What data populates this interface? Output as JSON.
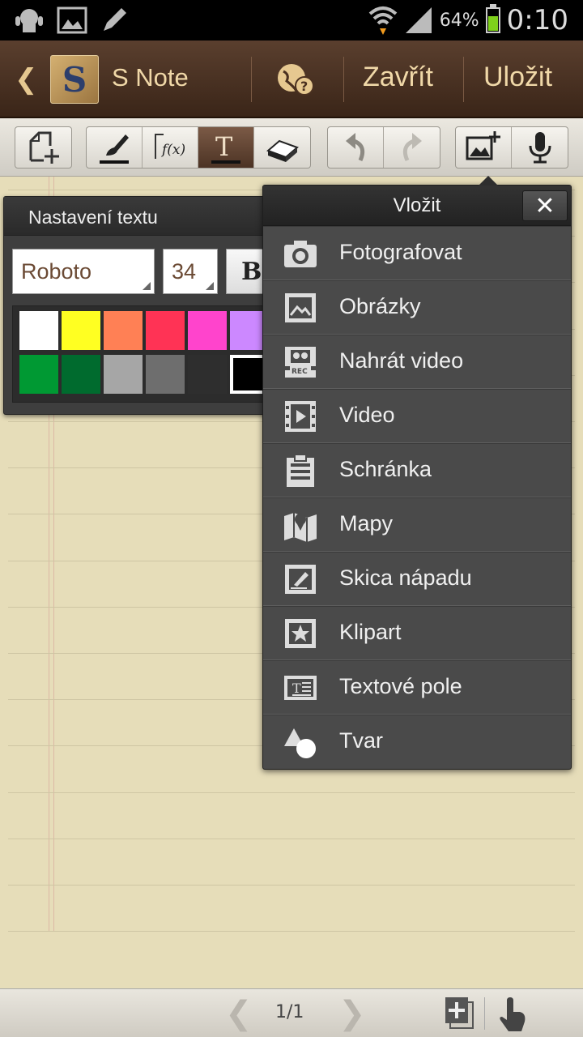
{
  "status_bar": {
    "battery_percent": "64%",
    "time": "0:10",
    "battery_level": 0.64
  },
  "title_bar": {
    "app_name": "S Note",
    "close_label": "Zavřít",
    "save_label": "Uložit"
  },
  "bottom_bar": {
    "page_indicator": "1/1"
  },
  "text_settings": {
    "title": "Nastavení textu",
    "font": "Roboto",
    "size": "34",
    "bold_label": "B",
    "colors_row1": [
      "#ffffff",
      "#ffff22",
      "#ff8055",
      "#ff3355",
      "#ff44cc",
      "#cc88ff"
    ],
    "colors_row2": [
      "#009933",
      "#006b2e",
      "#a6a6a6",
      "#6e6e6e",
      "#2e2e2e",
      "#000000"
    ],
    "selected_color": "#000000"
  },
  "insert_menu": {
    "title": "Vložit",
    "close_label": "✕",
    "items": [
      {
        "label": "Fotografovat",
        "icon": "camera-icon"
      },
      {
        "label": "Obrázky",
        "icon": "image-icon"
      },
      {
        "label": "Nahrát video",
        "icon": "record-video-icon"
      },
      {
        "label": "Video",
        "icon": "video-icon"
      },
      {
        "label": "Schránka",
        "icon": "clipboard-icon"
      },
      {
        "label": "Mapy",
        "icon": "map-icon"
      },
      {
        "label": "Skica nápadu",
        "icon": "sketch-icon"
      },
      {
        "label": "Klipart",
        "icon": "clipart-icon"
      },
      {
        "label": "Textové pole",
        "icon": "textbox-icon"
      },
      {
        "label": "Tvar",
        "icon": "shape-icon"
      }
    ]
  }
}
